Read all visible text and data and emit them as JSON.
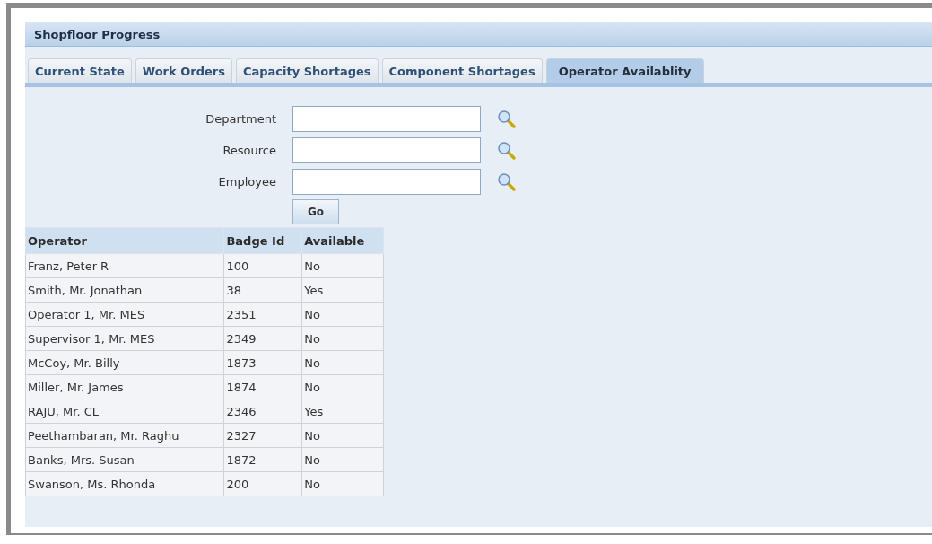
{
  "panel": {
    "title": "Shopfloor Progress"
  },
  "tabs": [
    {
      "label": "Current State",
      "selected": false
    },
    {
      "label": "Work Orders",
      "selected": false
    },
    {
      "label": "Capacity Shortages",
      "selected": false
    },
    {
      "label": "Component Shortages",
      "selected": false
    },
    {
      "label": "Operator Availablity",
      "selected": true
    }
  ],
  "search": {
    "fields": [
      {
        "label": "Department"
      },
      {
        "label": "Resource"
      },
      {
        "label": "Employee"
      }
    ],
    "go_button": "Go"
  },
  "table": {
    "columns": [
      "Operator",
      "Badge Id",
      "Available"
    ],
    "rows": [
      [
        "Franz, Peter R",
        "100",
        "No"
      ],
      [
        "Smith, Mr. Jonathan",
        "38",
        "Yes"
      ],
      [
        "Operator 1, Mr. MES",
        "2351",
        "No"
      ],
      [
        "Supervisor 1, Mr. MES",
        "2349",
        "No"
      ],
      [
        "McCoy, Mr. Billy",
        "1873",
        "No"
      ],
      [
        "Miller, Mr. James",
        "1874",
        "No"
      ],
      [
        "RAJU, Mr. CL",
        "2346",
        "Yes"
      ],
      [
        "Peethambaran, Mr. Raghu",
        "2327",
        "No"
      ],
      [
        "Banks, Mrs. Susan",
        "1872",
        "No"
      ],
      [
        "Swanson, Ms. Rhonda",
        "200",
        "No"
      ]
    ]
  }
}
